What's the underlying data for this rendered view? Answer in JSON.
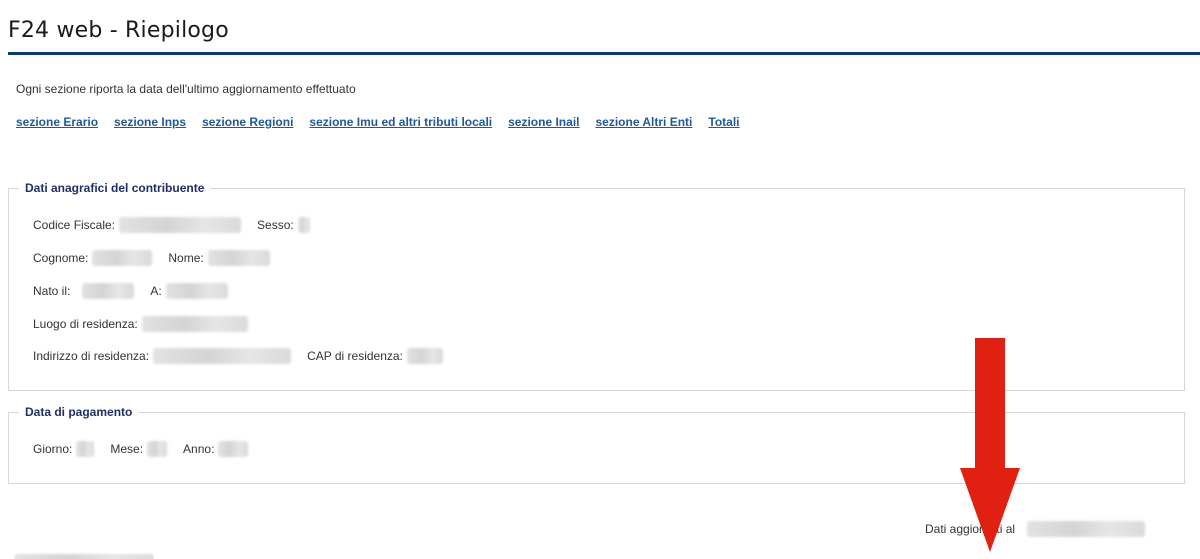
{
  "header": {
    "title": "F24 web - Riepilogo"
  },
  "intro": {
    "text": "Ogni sezione riporta la data dell'ultimo aggiornamento effettuato"
  },
  "nav": {
    "links": [
      {
        "label": "sezione Erario"
      },
      {
        "label": "sezione Inps"
      },
      {
        "label": "sezione Regioni"
      },
      {
        "label": "sezione Imu ed altri tributi locali"
      },
      {
        "label": "sezione Inail"
      },
      {
        "label": "sezione Altri Enti"
      },
      {
        "label": "Totali"
      }
    ]
  },
  "anagrafica": {
    "legend": "Dati anagrafici del contribuente",
    "codice_fiscale_label": "Codice Fiscale:",
    "sesso_label": "Sesso:",
    "cognome_label": "Cognome:",
    "nome_label": "Nome:",
    "nato_il_label": "Nato il:",
    "a_label": "A:",
    "luogo_residenza_label": "Luogo di residenza:",
    "indirizzo_residenza_label": "Indirizzo di residenza:",
    "cap_residenza_label": "CAP di residenza:"
  },
  "pagamento": {
    "legend": "Data di pagamento",
    "giorno_label": "Giorno:",
    "mese_label": "Mese:",
    "anno_label": "Anno:"
  },
  "footer": {
    "updated_label": "Dati aggiornati al"
  },
  "colors": {
    "title_rule": "#0b3a78",
    "link": "#1c5a9c",
    "legend": "#1f2f6b",
    "arrow": "#e02010"
  },
  "icons": {
    "annotation": "red-down-arrow-icon"
  }
}
